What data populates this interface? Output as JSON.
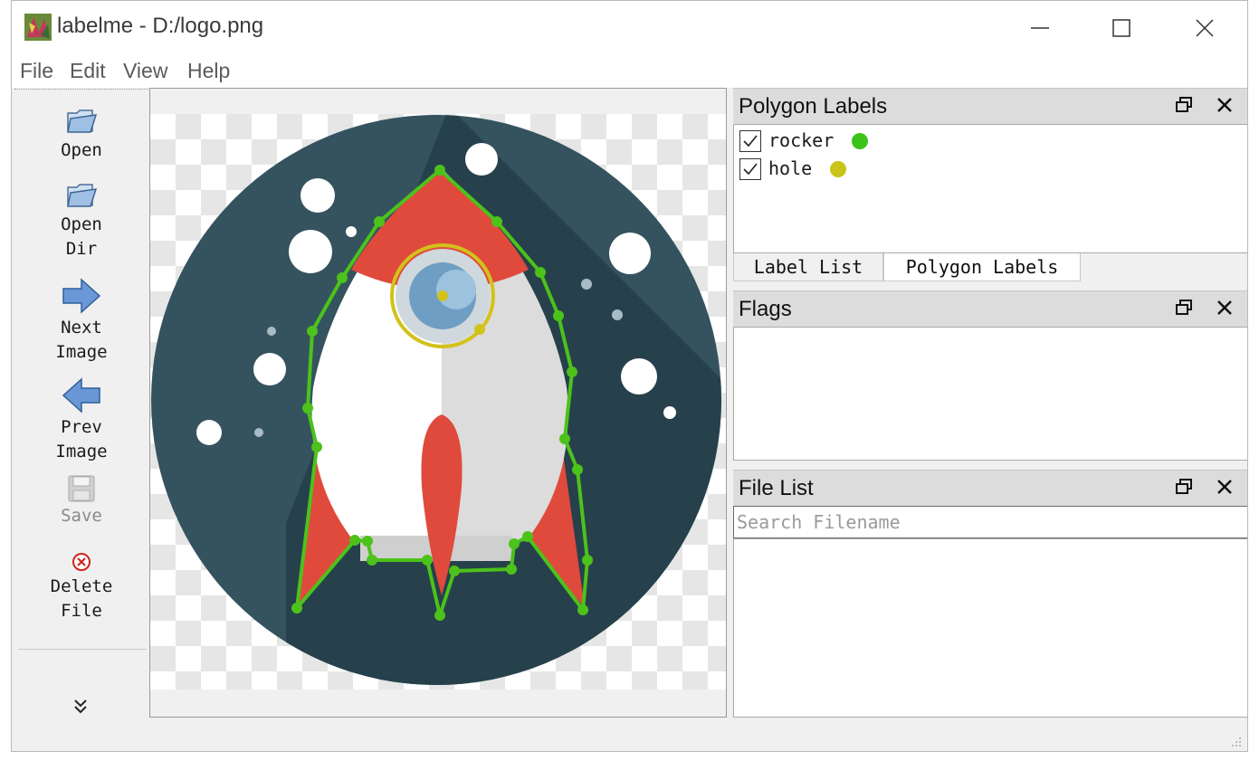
{
  "window": {
    "title": "labelme - D:/logo.png"
  },
  "menu": {
    "items": [
      "File",
      "Edit",
      "View",
      "Help"
    ]
  },
  "toolbar": {
    "open": "Open",
    "open_dir_line1": "Open",
    "open_dir_line2": "Dir",
    "next_line1": "Next",
    "next_line2": "Image",
    "prev_line1": "Prev",
    "prev_line2": "Image",
    "save": "Save",
    "delete_line1": "Delete",
    "delete_line2": "File"
  },
  "polygon_labels_dock": {
    "title": "Polygon Labels",
    "items": [
      {
        "label": "rocker",
        "checked": true,
        "color": "#3cc31a"
      },
      {
        "label": "hole",
        "checked": true,
        "color": "#c8c41a"
      }
    ],
    "tabs": [
      "Label List",
      "Polygon Labels"
    ],
    "active_tab": "Polygon Labels"
  },
  "flags_dock": {
    "title": "Flags"
  },
  "file_list_dock": {
    "title": "File List",
    "search_placeholder": "Search Filename"
  },
  "colors": {
    "rocker_polygon": "#4cc21a",
    "hole_polygon": "#d2c21a",
    "dock_header_bg": "#dcdcdc",
    "window_bg": "#f0f0f0"
  }
}
